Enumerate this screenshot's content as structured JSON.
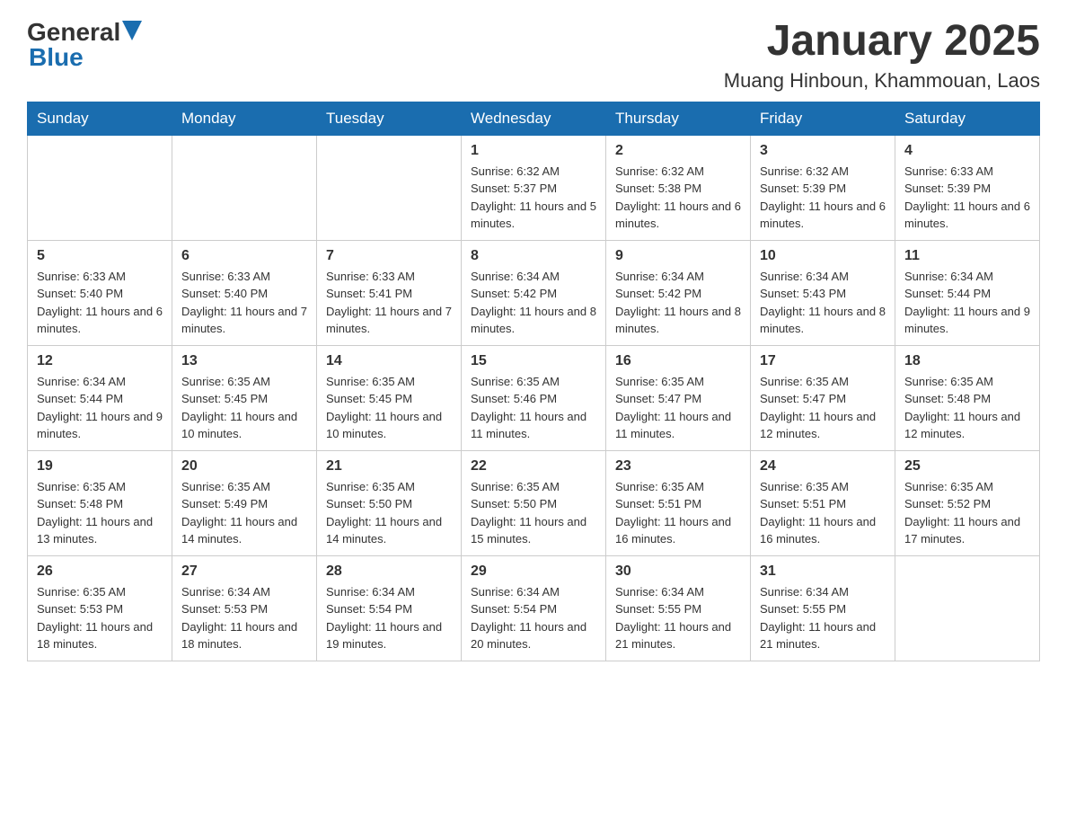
{
  "header": {
    "logo_general": "General",
    "logo_blue": "Blue",
    "title": "January 2025",
    "location": "Muang Hinboun, Khammouan, Laos"
  },
  "weekdays": [
    "Sunday",
    "Monday",
    "Tuesday",
    "Wednesday",
    "Thursday",
    "Friday",
    "Saturday"
  ],
  "weeks": [
    [
      {
        "day": "",
        "info": ""
      },
      {
        "day": "",
        "info": ""
      },
      {
        "day": "",
        "info": ""
      },
      {
        "day": "1",
        "info": "Sunrise: 6:32 AM\nSunset: 5:37 PM\nDaylight: 11 hours and 5 minutes."
      },
      {
        "day": "2",
        "info": "Sunrise: 6:32 AM\nSunset: 5:38 PM\nDaylight: 11 hours and 6 minutes."
      },
      {
        "day": "3",
        "info": "Sunrise: 6:32 AM\nSunset: 5:39 PM\nDaylight: 11 hours and 6 minutes."
      },
      {
        "day": "4",
        "info": "Sunrise: 6:33 AM\nSunset: 5:39 PM\nDaylight: 11 hours and 6 minutes."
      }
    ],
    [
      {
        "day": "5",
        "info": "Sunrise: 6:33 AM\nSunset: 5:40 PM\nDaylight: 11 hours and 6 minutes."
      },
      {
        "day": "6",
        "info": "Sunrise: 6:33 AM\nSunset: 5:40 PM\nDaylight: 11 hours and 7 minutes."
      },
      {
        "day": "7",
        "info": "Sunrise: 6:33 AM\nSunset: 5:41 PM\nDaylight: 11 hours and 7 minutes."
      },
      {
        "day": "8",
        "info": "Sunrise: 6:34 AM\nSunset: 5:42 PM\nDaylight: 11 hours and 8 minutes."
      },
      {
        "day": "9",
        "info": "Sunrise: 6:34 AM\nSunset: 5:42 PM\nDaylight: 11 hours and 8 minutes."
      },
      {
        "day": "10",
        "info": "Sunrise: 6:34 AM\nSunset: 5:43 PM\nDaylight: 11 hours and 8 minutes."
      },
      {
        "day": "11",
        "info": "Sunrise: 6:34 AM\nSunset: 5:44 PM\nDaylight: 11 hours and 9 minutes."
      }
    ],
    [
      {
        "day": "12",
        "info": "Sunrise: 6:34 AM\nSunset: 5:44 PM\nDaylight: 11 hours and 9 minutes."
      },
      {
        "day": "13",
        "info": "Sunrise: 6:35 AM\nSunset: 5:45 PM\nDaylight: 11 hours and 10 minutes."
      },
      {
        "day": "14",
        "info": "Sunrise: 6:35 AM\nSunset: 5:45 PM\nDaylight: 11 hours and 10 minutes."
      },
      {
        "day": "15",
        "info": "Sunrise: 6:35 AM\nSunset: 5:46 PM\nDaylight: 11 hours and 11 minutes."
      },
      {
        "day": "16",
        "info": "Sunrise: 6:35 AM\nSunset: 5:47 PM\nDaylight: 11 hours and 11 minutes."
      },
      {
        "day": "17",
        "info": "Sunrise: 6:35 AM\nSunset: 5:47 PM\nDaylight: 11 hours and 12 minutes."
      },
      {
        "day": "18",
        "info": "Sunrise: 6:35 AM\nSunset: 5:48 PM\nDaylight: 11 hours and 12 minutes."
      }
    ],
    [
      {
        "day": "19",
        "info": "Sunrise: 6:35 AM\nSunset: 5:48 PM\nDaylight: 11 hours and 13 minutes."
      },
      {
        "day": "20",
        "info": "Sunrise: 6:35 AM\nSunset: 5:49 PM\nDaylight: 11 hours and 14 minutes."
      },
      {
        "day": "21",
        "info": "Sunrise: 6:35 AM\nSunset: 5:50 PM\nDaylight: 11 hours and 14 minutes."
      },
      {
        "day": "22",
        "info": "Sunrise: 6:35 AM\nSunset: 5:50 PM\nDaylight: 11 hours and 15 minutes."
      },
      {
        "day": "23",
        "info": "Sunrise: 6:35 AM\nSunset: 5:51 PM\nDaylight: 11 hours and 16 minutes."
      },
      {
        "day": "24",
        "info": "Sunrise: 6:35 AM\nSunset: 5:51 PM\nDaylight: 11 hours and 16 minutes."
      },
      {
        "day": "25",
        "info": "Sunrise: 6:35 AM\nSunset: 5:52 PM\nDaylight: 11 hours and 17 minutes."
      }
    ],
    [
      {
        "day": "26",
        "info": "Sunrise: 6:35 AM\nSunset: 5:53 PM\nDaylight: 11 hours and 18 minutes."
      },
      {
        "day": "27",
        "info": "Sunrise: 6:34 AM\nSunset: 5:53 PM\nDaylight: 11 hours and 18 minutes."
      },
      {
        "day": "28",
        "info": "Sunrise: 6:34 AM\nSunset: 5:54 PM\nDaylight: 11 hours and 19 minutes."
      },
      {
        "day": "29",
        "info": "Sunrise: 6:34 AM\nSunset: 5:54 PM\nDaylight: 11 hours and 20 minutes."
      },
      {
        "day": "30",
        "info": "Sunrise: 6:34 AM\nSunset: 5:55 PM\nDaylight: 11 hours and 21 minutes."
      },
      {
        "day": "31",
        "info": "Sunrise: 6:34 AM\nSunset: 5:55 PM\nDaylight: 11 hours and 21 minutes."
      },
      {
        "day": "",
        "info": ""
      }
    ]
  ]
}
